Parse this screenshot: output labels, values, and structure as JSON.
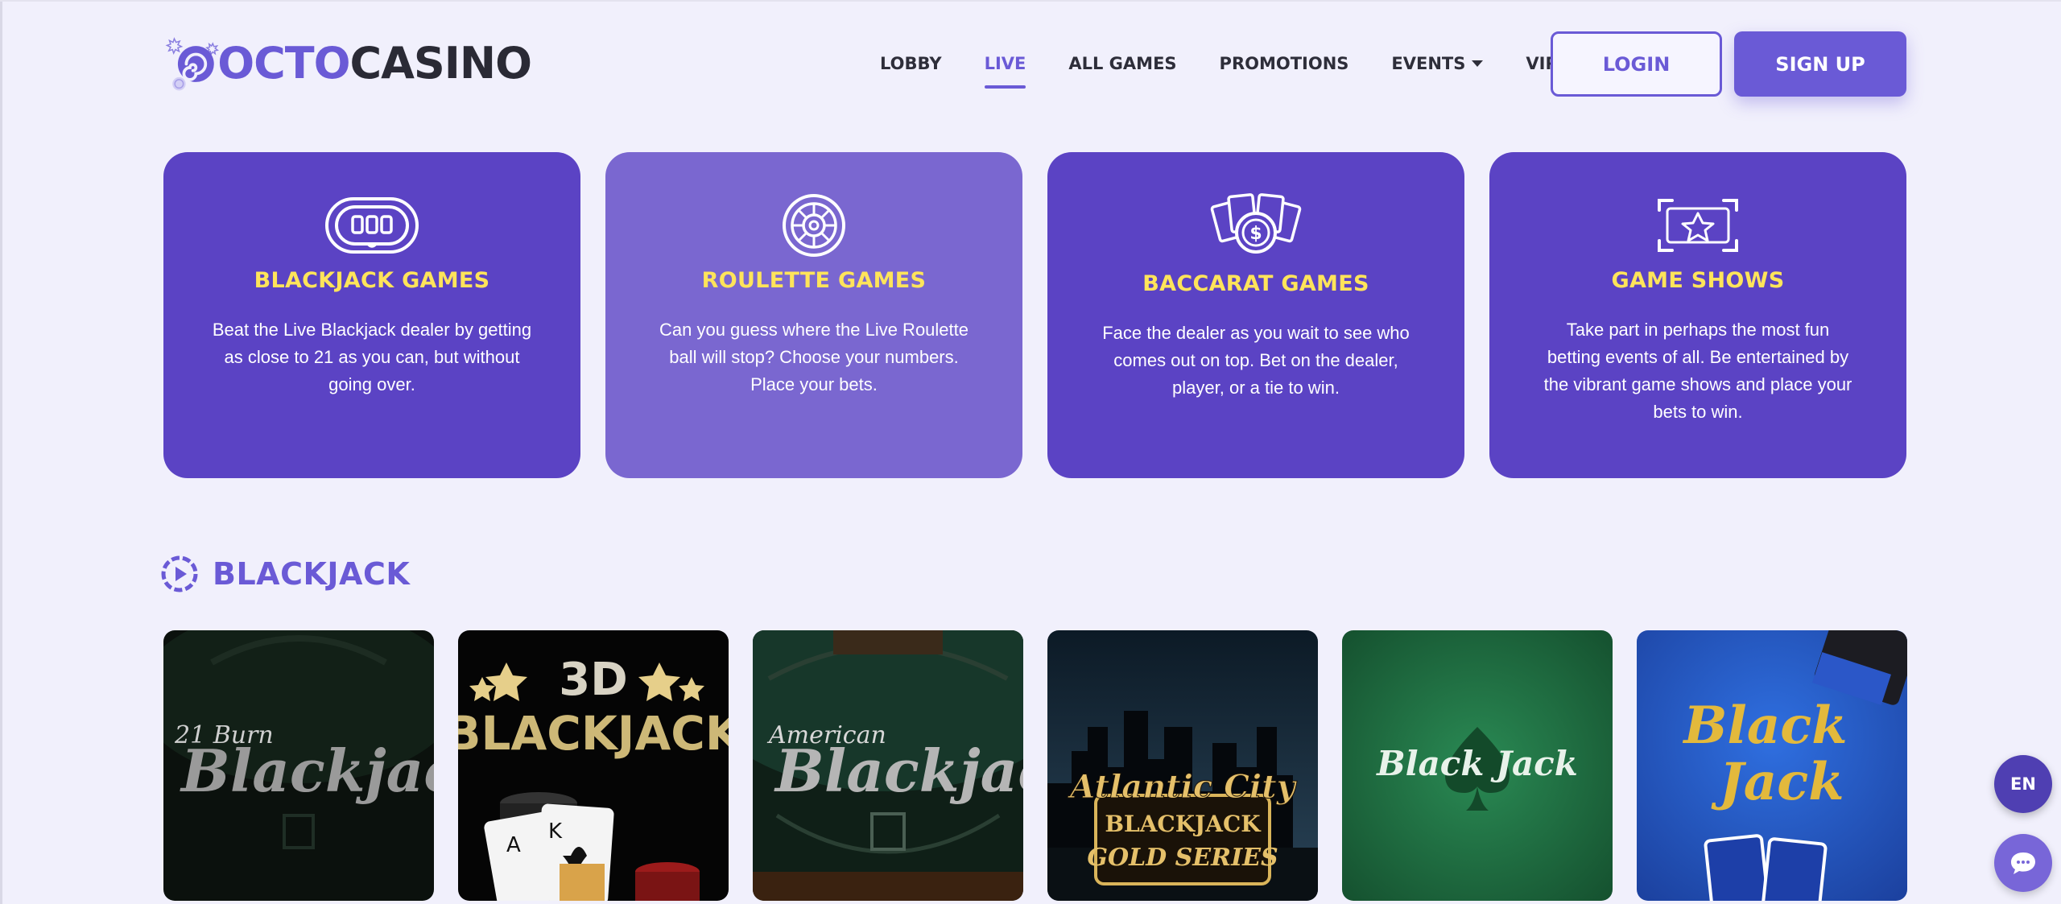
{
  "brand": {
    "octo": "OCTO",
    "casino": "CASINO"
  },
  "nav": {
    "items": [
      {
        "label": "LOBBY"
      },
      {
        "label": "LIVE"
      },
      {
        "label": "ALL GAMES"
      },
      {
        "label": "PROMOTIONS"
      },
      {
        "label": "EVENTS"
      },
      {
        "label": "VIP"
      }
    ],
    "active": "LIVE"
  },
  "auth": {
    "login": "LOGIN",
    "signup": "SIGN UP"
  },
  "categories": [
    {
      "title": "BLACKJACK GAMES",
      "description": "Beat the Live Blackjack dealer by getting as close to 21 as you can, but without going over.",
      "icon": "blackjack-table-icon"
    },
    {
      "title": "ROULETTE GAMES",
      "description": "Can you guess where the Live Roulette ball will stop? Choose your numbers. Place your bets.",
      "icon": "roulette-wheel-icon"
    },
    {
      "title": "BACCARAT GAMES",
      "description": "Face the dealer as you wait to see who comes out on top. Bet on the dealer, player, or a tie to win.",
      "icon": "cards-coin-icon"
    },
    {
      "title": "GAME SHOWS",
      "description": "Take part in perhaps the most fun betting events of all. Be entertained by the vibrant game shows and place your bets to win.",
      "icon": "star-frame-icon"
    }
  ],
  "section": {
    "title": "BLACKJACK",
    "icon": "play-circle-icon"
  },
  "games": [
    {
      "top": "21 Burn",
      "main": "Blackjack"
    },
    {
      "top": "3D",
      "main": "BLACKJACK"
    },
    {
      "top": "American",
      "main": "Blackjack"
    },
    {
      "top": "Atlantic City",
      "main": "BLACKJACK",
      "sub": "GOLD SERIES"
    },
    {
      "main": "Black Jack"
    },
    {
      "main": "Black",
      "sub": "Jack"
    }
  ],
  "widgets": {
    "language": "EN",
    "chat_icon": "chat-bubble-icon"
  },
  "colors": {
    "accent": "#6a5ad6",
    "card": "#5b43c4",
    "card_light": "#7a67d0",
    "title_yellow": "#ffe45a",
    "background": "#f1f0fc"
  }
}
